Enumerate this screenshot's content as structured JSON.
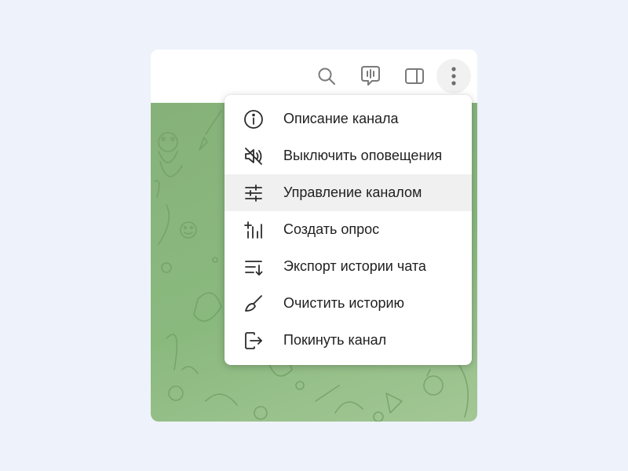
{
  "header": {
    "buttons": [
      {
        "icon": "search-icon"
      },
      {
        "icon": "video-chat-icon"
      },
      {
        "icon": "sidebar-panel-icon"
      },
      {
        "icon": "more-vertical-icon"
      }
    ]
  },
  "menu": {
    "items": [
      {
        "label": "Описание канала",
        "icon": "info-icon"
      },
      {
        "label": "Выключить оповещения",
        "icon": "mute-icon"
      },
      {
        "label": "Управление каналом",
        "icon": "sliders-icon",
        "hovered": true
      },
      {
        "label": "Создать опрос",
        "icon": "poll-icon"
      },
      {
        "label": "Экспорт истории чата",
        "icon": "export-icon"
      },
      {
        "label": "Очистить историю",
        "icon": "broom-icon"
      },
      {
        "label": "Покинуть канал",
        "icon": "leave-icon"
      }
    ]
  },
  "colors": {
    "page_background": "#eef2fb",
    "chat_background": "#8ab97e",
    "icon": "#7a7a7a",
    "menu_icon": "#2b2b2b",
    "text": "#1f1f1f"
  }
}
